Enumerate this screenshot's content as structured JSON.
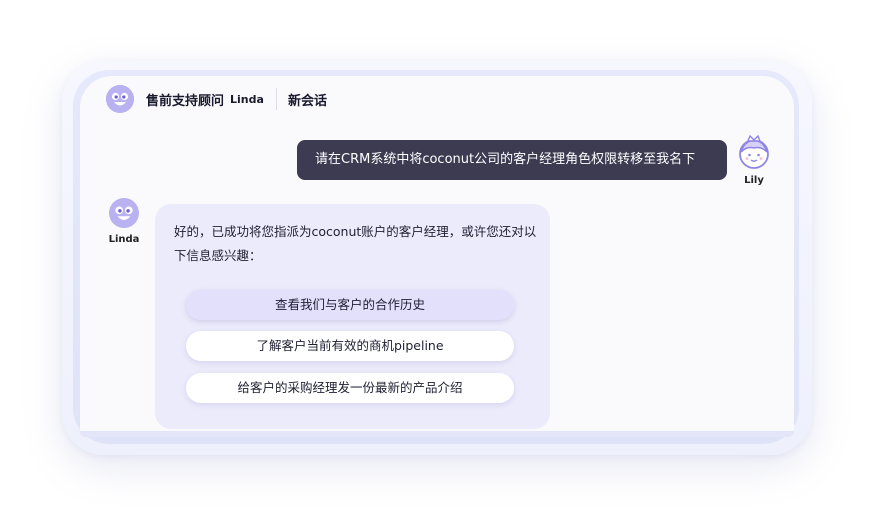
{
  "header": {
    "title": "售前支持顾问",
    "agent_name": "Linda",
    "new_chat": "新会话"
  },
  "user": {
    "name": "Lily",
    "message": "请在CRM系统中将coconut公司的客户经理角色权限转移至我名下"
  },
  "bot": {
    "name": "Linda",
    "reply": "好的，已成功将您指派为coconut账户的客户经理，或许您还对以下信息感兴趣：",
    "suggestions": [
      "查看我们与客户的合作历史",
      "了解客户当前有效的商机pipeline",
      "给客户的采购经理发一份最新的产品介绍"
    ]
  },
  "colors": {
    "accent": "#b9b2f1",
    "user_bubble": "#3d3b52",
    "bot_bubble": "#ecebfb",
    "suggestion_active": "#e2e0fb"
  },
  "icons": {
    "bot_avatar": "smiling-face-icon",
    "user_avatar": "girl-with-crown-icon"
  }
}
